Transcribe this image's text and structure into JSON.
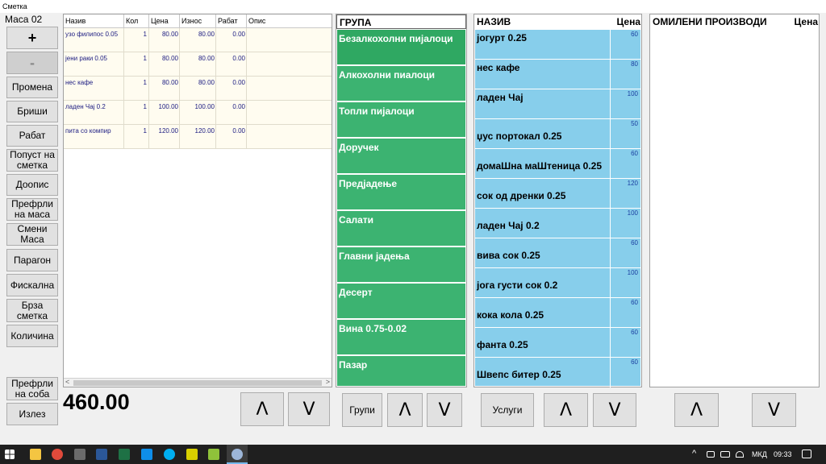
{
  "window": {
    "title": "Сметка"
  },
  "left": {
    "table_label": "Маса 02",
    "buttons": [
      {
        "label": "+"
      },
      {
        "label": "-"
      },
      {
        "label": "Промена"
      },
      {
        "label": "Бриши"
      },
      {
        "label": "Рабат"
      },
      {
        "label": "Попуст на сметка"
      },
      {
        "label": "Доопис"
      },
      {
        "label": "Префрли на маса"
      },
      {
        "label": "Смени Маса"
      },
      {
        "label": "Парагон"
      },
      {
        "label": "Фискална"
      },
      {
        "label": "Брза сметка"
      },
      {
        "label": "Количина"
      },
      {
        "label": "Префрли на соба"
      },
      {
        "label": "Излез"
      }
    ]
  },
  "order": {
    "headers": [
      "Назив",
      "Кол",
      "Цена",
      "Износ",
      "Рабат",
      "Опис"
    ],
    "rows": [
      [
        "узо филипос 0.05",
        "1",
        "80.00",
        "80.00",
        "0.00",
        ""
      ],
      [
        "јени раки 0.05",
        "1",
        "80.00",
        "80.00",
        "0.00",
        ""
      ],
      [
        "нес кафе",
        "1",
        "80.00",
        "80.00",
        "0.00",
        ""
      ],
      [
        "ладен Чај 0.2",
        "1",
        "100.00",
        "100.00",
        "0.00",
        ""
      ],
      [
        "пита со компир",
        "1",
        "120.00",
        "120.00",
        "0.00",
        ""
      ]
    ],
    "total": "460.00",
    "scroll_left": "<",
    "scroll_right": ">"
  },
  "nav": {
    "up": "Λ",
    "down": "V"
  },
  "groups": {
    "header": "ГРУПА",
    "items": [
      "Безалкохолни пијалоци",
      "Алкохолни пиалоци",
      "Топли пијалоци",
      "Доручек",
      "Предјадење",
      "Салати",
      "Главни јадења",
      "Десерт",
      "Вина 0.75-0.02",
      "Пазар"
    ],
    "button": "Групи"
  },
  "products": {
    "header_name": "НАЗИВ",
    "header_price": "Цена",
    "items": [
      {
        "name": "јогурт 0.25",
        "price": "60"
      },
      {
        "name": "нес кафе",
        "price": "80"
      },
      {
        "name": "ладен Чај",
        "price": "100"
      },
      {
        "name": "џус портокал  0.25",
        "price": "50"
      },
      {
        "name": "домаШна маШтеница 0.25",
        "price": "60"
      },
      {
        "name": "сок од дренки 0.25",
        "price": "120"
      },
      {
        "name": "ладен Чај 0.2",
        "price": "100"
      },
      {
        "name": "вива сок 0.25",
        "price": "60"
      },
      {
        "name": "јога густи сок 0.2",
        "price": "100"
      },
      {
        "name": "кока кола 0.25",
        "price": "60"
      },
      {
        "name": "фанта 0.25",
        "price": "60"
      },
      {
        "name": "Швепс битер 0.25",
        "price": "60"
      }
    ],
    "button": "Услуги"
  },
  "favorites": {
    "header_name": "ОМИЛЕНИ ПРОИЗВОДИ",
    "header_price": "Цена"
  },
  "taskbar": {
    "lang": "МКД",
    "time": "09:33",
    "icons": [
      "start-icon",
      "file-explorer-icon",
      "chrome-icon",
      "calculator-icon",
      "word-icon",
      "excel-icon",
      "teamviewer-icon",
      "skype-icon",
      "sevenzip-icon",
      "app-icon",
      "pos-app-icon"
    ]
  }
}
